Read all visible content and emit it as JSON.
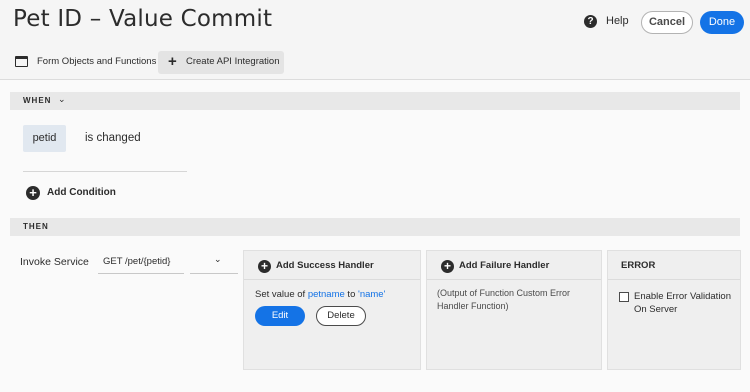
{
  "header": {
    "title": "Pet ID – Value Commit",
    "help_icon": "?",
    "help_label": "Help",
    "cancel_label": "Cancel",
    "done_label": "Done"
  },
  "toolbar": {
    "form_objects_label": "Form Objects and Functions",
    "create_api_label": "Create API Integration",
    "plus_glyph": "+"
  },
  "when": {
    "label": "WHEN",
    "chevron": "⌄",
    "condition": {
      "object": "petid",
      "operator": "is changed"
    },
    "add_icon": "+",
    "add_condition_label": "Add Condition"
  },
  "then": {
    "label": "THEN",
    "invoke_label": "Invoke Service",
    "service_value": "GET /pet/{petid}",
    "dropdown_chevron": "⌄",
    "success": {
      "icon": "+",
      "title": "Add Success Handler",
      "text_prefix": "Set value of ",
      "text_field": "petname",
      "text_mid": " to ",
      "text_value": "'name'",
      "edit_label": "Edit",
      "delete_label": "Delete"
    },
    "failure": {
      "icon": "+",
      "title": "Add Failure Handler",
      "text": "(Output of Function Custom Error Handler Function)"
    },
    "error": {
      "title": "ERROR",
      "checkbox_label": "Enable Error Validation On Server",
      "checked": false
    }
  },
  "colors": {
    "accent": "#1473e6",
    "chip": "#e1e8f0"
  }
}
